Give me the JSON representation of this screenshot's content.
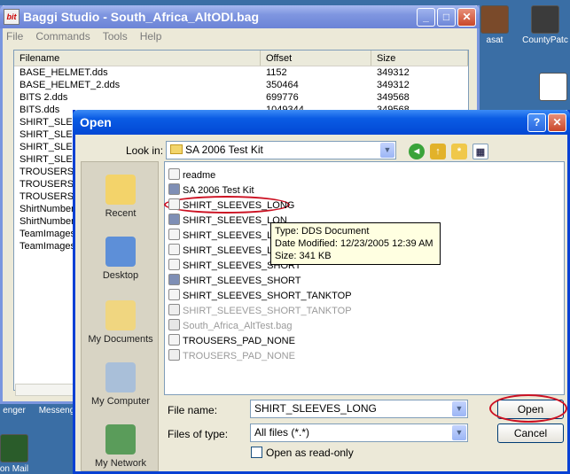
{
  "desktop": {
    "icons": [
      "asat",
      "CountyPatc",
      "enger",
      "Messeng",
      "on Mail"
    ]
  },
  "baggi": {
    "title": "Baggi Studio - South_Africa_AltODI.bag",
    "menu": [
      "File",
      "Commands",
      "Tools",
      "Help"
    ],
    "columns": [
      "Filename",
      "Offset",
      "Size"
    ],
    "rows": [
      [
        "BASE_HELMET.dds",
        "1152",
        "349312"
      ],
      [
        "BASE_HELMET_2.dds",
        "350464",
        "349312"
      ],
      [
        "BITS 2.dds",
        "699776",
        "349568"
      ],
      [
        "BITS.dds",
        "1049344",
        "349568"
      ],
      [
        "SHIRT_SLEE",
        "",
        ""
      ],
      [
        "SHIRT_SLEE",
        "",
        ""
      ],
      [
        "SHIRT_SLEE",
        "",
        ""
      ],
      [
        "SHIRT_SLEE",
        "",
        ""
      ],
      [
        "TROUSERS",
        "",
        ""
      ],
      [
        "TROUSERS",
        "",
        ""
      ],
      [
        "TROUSERS",
        "",
        ""
      ],
      [
        "ShirtNumbers",
        "",
        ""
      ],
      [
        "ShirtNumbers",
        "",
        ""
      ],
      [
        "TeamImages",
        "",
        ""
      ],
      [
        "TeamImages",
        "",
        ""
      ]
    ]
  },
  "open": {
    "title": "Open",
    "look_in_label": "Look in:",
    "look_in_value": "SA 2006 Test Kit",
    "places": [
      "Recent",
      "Desktop",
      "My Documents",
      "My Computer",
      "My Network"
    ],
    "files": [
      {
        "name": "readme",
        "ghost": false
      },
      {
        "name": "SA 2006 Test Kit",
        "ghost": false
      },
      {
        "name": "SHIRT_SLEEVES_LONG",
        "ghost": false
      },
      {
        "name": "SHIRT_SLEEVES_LON",
        "ghost": false
      },
      {
        "name": "SHIRT_SLEEVES_LON",
        "ghost": false
      },
      {
        "name": "SHIRT_SLEEVES_LON",
        "ghost": false
      },
      {
        "name": "SHIRT_SLEEVES_SHORT",
        "ghost": false
      },
      {
        "name": "SHIRT_SLEEVES_SHORT",
        "ghost": false
      },
      {
        "name": "SHIRT_SLEEVES_SHORT_TANKTOP",
        "ghost": false
      },
      {
        "name": "SHIRT_SLEEVES_SHORT_TANKTOP",
        "ghost": true
      },
      {
        "name": "South_Africa_AltTest.bag",
        "ghost": true
      },
      {
        "name": "TROUSERS_PAD_NONE",
        "ghost": false
      },
      {
        "name": "TROUSERS_PAD_NONE",
        "ghost": true
      }
    ],
    "tooltip": {
      "type": "Type: DDS Document",
      "modified": "Date Modified: 12/23/2005 12:39 AM",
      "size": "Size: 341 KB"
    },
    "file_name_label": "File name:",
    "file_name_value": "SHIRT_SLEEVES_LONG",
    "files_of_type_label": "Files of type:",
    "files_of_type_value": "All files (*.*)",
    "read_only_label": "Open as read-only",
    "open_button": "Open",
    "cancel_button": "Cancel",
    "help_glyph": "?",
    "close_glyph": "✕"
  },
  "colors": {
    "highlight_circle": "#cc1122",
    "dialog_title": "#0247d4"
  }
}
